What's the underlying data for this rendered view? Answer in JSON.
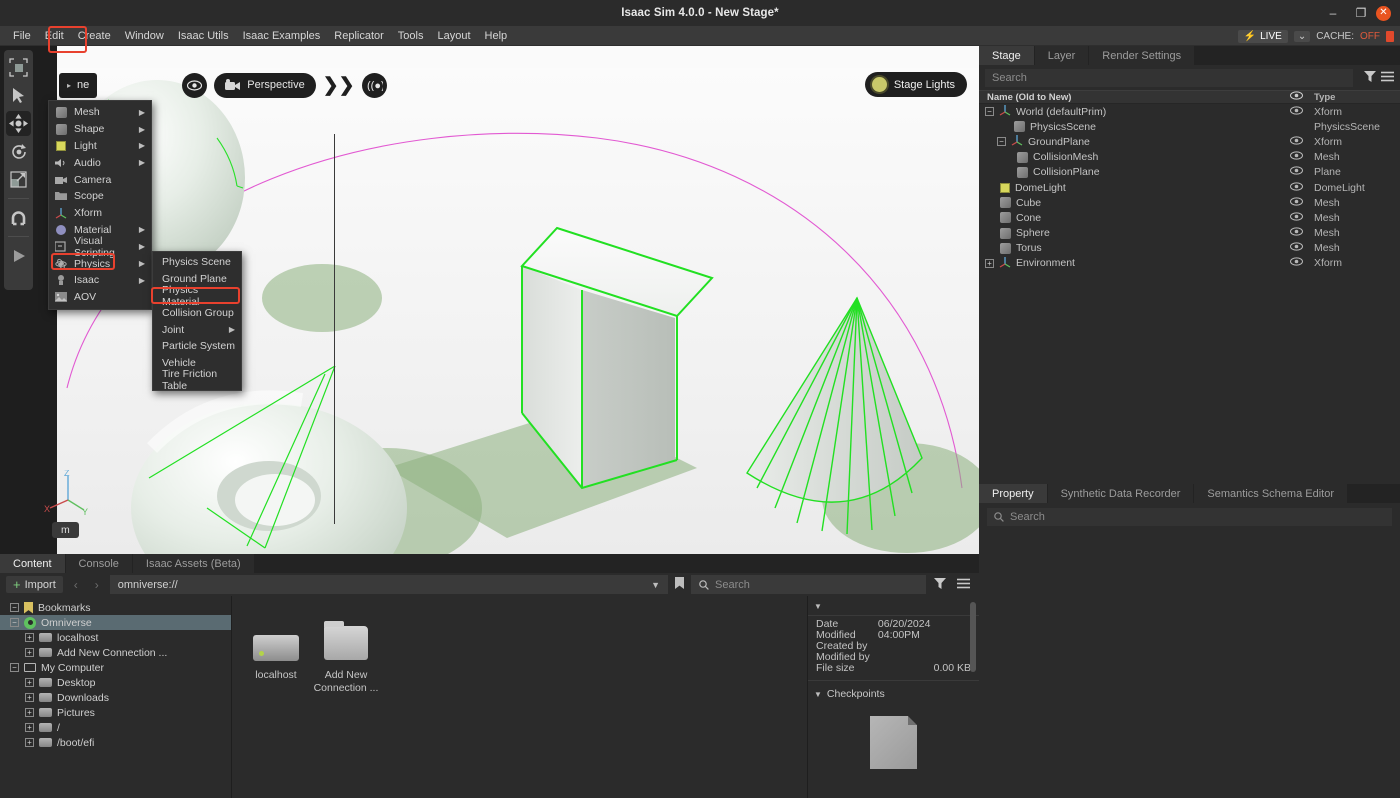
{
  "window": {
    "title": "Isaac Sim 4.0.0 - New Stage*",
    "minimize": "–",
    "maximize": "❐",
    "close": "✕"
  },
  "menubar": {
    "items": [
      "File",
      "Edit",
      "Create",
      "Window",
      "Isaac Utils",
      "Isaac Examples",
      "Replicator",
      "Tools",
      "Layout",
      "Help"
    ],
    "highlighted": "Create"
  },
  "status": {
    "live_label": "LIVE",
    "live_caret": "⌄",
    "cache_label": "CACHE:",
    "cache_value": "OFF"
  },
  "create_menu": {
    "items": [
      {
        "label": "Mesh",
        "icon": "mesh-icon",
        "submenu": true
      },
      {
        "label": "Shape",
        "icon": "shape-icon",
        "submenu": true
      },
      {
        "label": "Light",
        "icon": "light-icon",
        "submenu": true
      },
      {
        "label": "Audio",
        "icon": "audio-icon",
        "submenu": true
      },
      {
        "label": "Camera",
        "icon": "camera-icon",
        "submenu": false
      },
      {
        "label": "Scope",
        "icon": "folder-icon",
        "submenu": false
      },
      {
        "label": "Xform",
        "icon": "xform-icon",
        "submenu": false
      },
      {
        "label": "Material",
        "icon": "material-icon",
        "submenu": true
      },
      {
        "label": "Visual Scripting",
        "icon": "script-icon",
        "submenu": true
      },
      {
        "label": "Physics",
        "icon": "physics-icon",
        "submenu": true
      },
      {
        "label": "Isaac",
        "icon": "isaac-icon",
        "submenu": true
      },
      {
        "label": "AOV",
        "icon": "aov-icon",
        "submenu": false
      }
    ],
    "highlighted": "Physics"
  },
  "physics_submenu": {
    "items": [
      {
        "label": "Physics Scene",
        "submenu": false
      },
      {
        "label": "Ground Plane",
        "submenu": false
      },
      {
        "label": "Physics Material",
        "submenu": false
      },
      {
        "label": "Collision Group",
        "submenu": false
      },
      {
        "label": "Joint",
        "submenu": true
      },
      {
        "label": "Particle System",
        "submenu": false
      },
      {
        "label": "Vehicle",
        "submenu": false
      },
      {
        "label": "Tire Friction Table",
        "submenu": false
      }
    ],
    "highlighted": "Physics Material"
  },
  "viewport": {
    "toolbar": {
      "scene_label": "ne",
      "eye_icon": "eye-icon",
      "camera_label": "Perspective",
      "chevrons": "❯❯",
      "render_icon": "render-mode-icon"
    },
    "stage_lights": "Stage Lights",
    "unit": "m",
    "axis": {
      "x": "X",
      "y": "Y",
      "z": "Z"
    },
    "left_tools": [
      {
        "name": "select-mode-icon",
        "selected": false
      },
      {
        "name": "pointer-icon",
        "selected": false
      },
      {
        "name": "move-tool-icon",
        "selected": true
      },
      {
        "name": "rotate-tool-icon",
        "selected": false
      },
      {
        "name": "scale-tool-icon",
        "selected": false
      },
      {
        "name": "snap-magnet-icon",
        "selected": false
      },
      {
        "name": "play-icon",
        "selected": false
      }
    ]
  },
  "content_browser": {
    "tabs": [
      {
        "label": "Content",
        "active": true
      },
      {
        "label": "Console",
        "active": false
      },
      {
        "label": "Isaac Assets (Beta)",
        "active": false
      }
    ],
    "import_label": "Import",
    "nav_back": "‹",
    "nav_forward": "›",
    "path": "omniverse://",
    "search_placeholder": "Search",
    "tree": [
      {
        "label": "Bookmarks",
        "icon": "bookmark-icon",
        "indent": 0,
        "expander": "−",
        "selected": false
      },
      {
        "label": "Omniverse",
        "icon": "omniverse-icon",
        "indent": 0,
        "expander": "−",
        "selected": true
      },
      {
        "label": "localhost",
        "icon": "drive-icon",
        "indent": 1,
        "expander": "+",
        "selected": false
      },
      {
        "label": "Add New Connection ...",
        "icon": "add-connection-icon",
        "indent": 1,
        "expander": "+",
        "selected": false
      },
      {
        "label": "My Computer",
        "icon": "monitor-icon",
        "indent": 0,
        "expander": "−",
        "selected": false
      },
      {
        "label": "Desktop",
        "icon": "drive-icon",
        "indent": 1,
        "expander": "+",
        "selected": false
      },
      {
        "label": "Downloads",
        "icon": "drive-icon",
        "indent": 1,
        "expander": "+",
        "selected": false
      },
      {
        "label": "Pictures",
        "icon": "drive-icon",
        "indent": 1,
        "expander": "+",
        "selected": false
      },
      {
        "label": "/",
        "icon": "drive-icon",
        "indent": 1,
        "expander": "+",
        "selected": false
      },
      {
        "label": "/boot/efi",
        "icon": "drive-icon",
        "indent": 1,
        "expander": "+",
        "selected": false
      }
    ],
    "grid_items": [
      {
        "label": "localhost",
        "icon": "server-icon"
      },
      {
        "label": "Add New Connection ...",
        "icon": "folder-icon"
      }
    ],
    "details": {
      "date_modified_label": "Date Modified",
      "date_modified_value": "06/20/2024 04:00PM",
      "created_by_label": "Created by",
      "created_by_value": "",
      "modified_by_label": "Modified by",
      "modified_by_value": "",
      "file_size_label": "File size",
      "file_size_value": "0.00 KB",
      "checkpoints_label": "Checkpoints"
    }
  },
  "stage_panel": {
    "tabs": [
      {
        "label": "Stage",
        "active": true
      },
      {
        "label": "Layer",
        "active": false
      },
      {
        "label": "Render Settings",
        "active": false
      }
    ],
    "search_placeholder": "Search",
    "col_name": "Name (Old to New)",
    "col_type": "Type",
    "filter_icon": "filter-icon",
    "options_icon": "hamburger-icon",
    "rows": [
      {
        "name": "World (defaultPrim)",
        "type": "Xform",
        "indent": 0,
        "expander": "−",
        "icon": "xform-icon",
        "eye": true
      },
      {
        "name": "PhysicsScene",
        "type": "PhysicsScene",
        "indent": 1,
        "expander": "",
        "icon": "mesh-icon",
        "eye": false
      },
      {
        "name": "GroundPlane",
        "type": "Xform",
        "indent": 1,
        "expander": "−",
        "icon": "xform-icon",
        "eye": true
      },
      {
        "name": "CollisionMesh",
        "type": "Mesh",
        "indent": 2,
        "expander": "",
        "icon": "mesh-icon",
        "eye": true
      },
      {
        "name": "CollisionPlane",
        "type": "Plane",
        "indent": 2,
        "expander": "",
        "icon": "mesh-icon",
        "eye": true
      },
      {
        "name": "DomeLight",
        "type": "DomeLight",
        "indent": 1,
        "expander": "",
        "icon": "light-icon",
        "eye": true
      },
      {
        "name": "Cube",
        "type": "Mesh",
        "indent": 1,
        "expander": "",
        "icon": "mesh-icon",
        "eye": true
      },
      {
        "name": "Cone",
        "type": "Mesh",
        "indent": 1,
        "expander": "",
        "icon": "mesh-icon",
        "eye": true
      },
      {
        "name": "Sphere",
        "type": "Mesh",
        "indent": 1,
        "expander": "",
        "icon": "mesh-icon",
        "eye": true
      },
      {
        "name": "Torus",
        "type": "Mesh",
        "indent": 1,
        "expander": "",
        "icon": "mesh-icon",
        "eye": true
      },
      {
        "name": "Environment",
        "type": "Xform",
        "indent": 0,
        "expander": "+",
        "icon": "xform-icon",
        "eye": true
      }
    ]
  },
  "property_panel": {
    "tabs": [
      {
        "label": "Property",
        "active": true
      },
      {
        "label": "Synthetic Data Recorder",
        "active": false
      },
      {
        "label": "Semantics Schema Editor",
        "active": false
      }
    ],
    "search_placeholder": "Search"
  },
  "colors": {
    "accent_red": "#e8412e",
    "live_green": "#f5d44a",
    "cache_off": "#e05a3c",
    "selection_blue": "#5a6b72",
    "wire_green": "#22e022",
    "orbit_magenta": "#e050d0"
  }
}
